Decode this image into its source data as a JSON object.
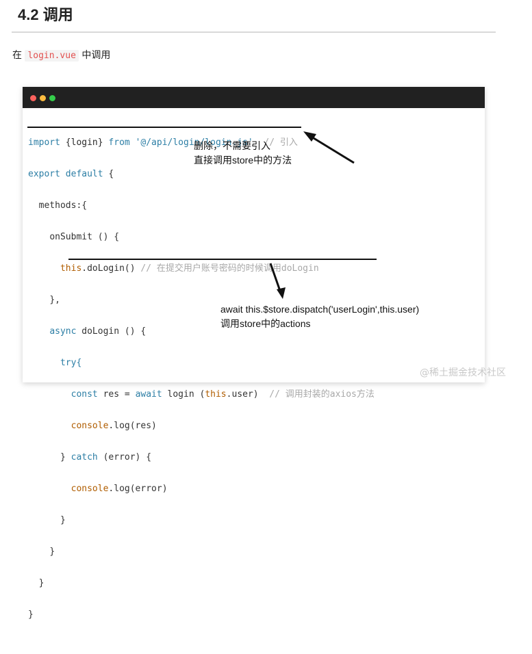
{
  "heading": "4.2 调用",
  "para": {
    "prefix": "在",
    "file": "login.vue",
    "suffix": "中调用"
  },
  "code": {
    "l1_import": "import",
    "l1_name": "{login}",
    "l1_from": "from",
    "l1_path": "'@/api/login/login.js'",
    "l1_comment": "// 引入",
    "l2_export": "export default",
    "l2_brace": "{",
    "l3": "methods:{",
    "l4": "onSubmit () {",
    "l5_this": "this",
    "l5_call": ".doLogin()",
    "l5_comment": "// 在提交用户账号密码的时候调用doLogin",
    "l6": "},",
    "l7_async": "async",
    "l7_rest": "doLogin () {",
    "l8": "try{",
    "l9_const": "const",
    "l9_res": "res =",
    "l9_await": "await",
    "l9_login": "login (",
    "l9_this": "this",
    "l9_user": ".user)",
    "l9_comment": "// 调用封装的axios方法",
    "l10_console": "console",
    "l10_rest": ".log(res)",
    "l11_close": "}",
    "l11_catch": "catch",
    "l11_rest": "(error) {",
    "l12_console": "console",
    "l12_rest": ".log(error)",
    "l13": "}",
    "l14": "}",
    "l15": "}",
    "l16": "}"
  },
  "notes": {
    "n1_line1": "删除，不需要引入",
    "n1_line2": "直接调用store中的方法",
    "n2_line1": "await this.$store.dispatch('userLogin',this.user)",
    "n2_line2": "调用store中的actions"
  },
  "watermark": "@稀土掘金技术社区"
}
